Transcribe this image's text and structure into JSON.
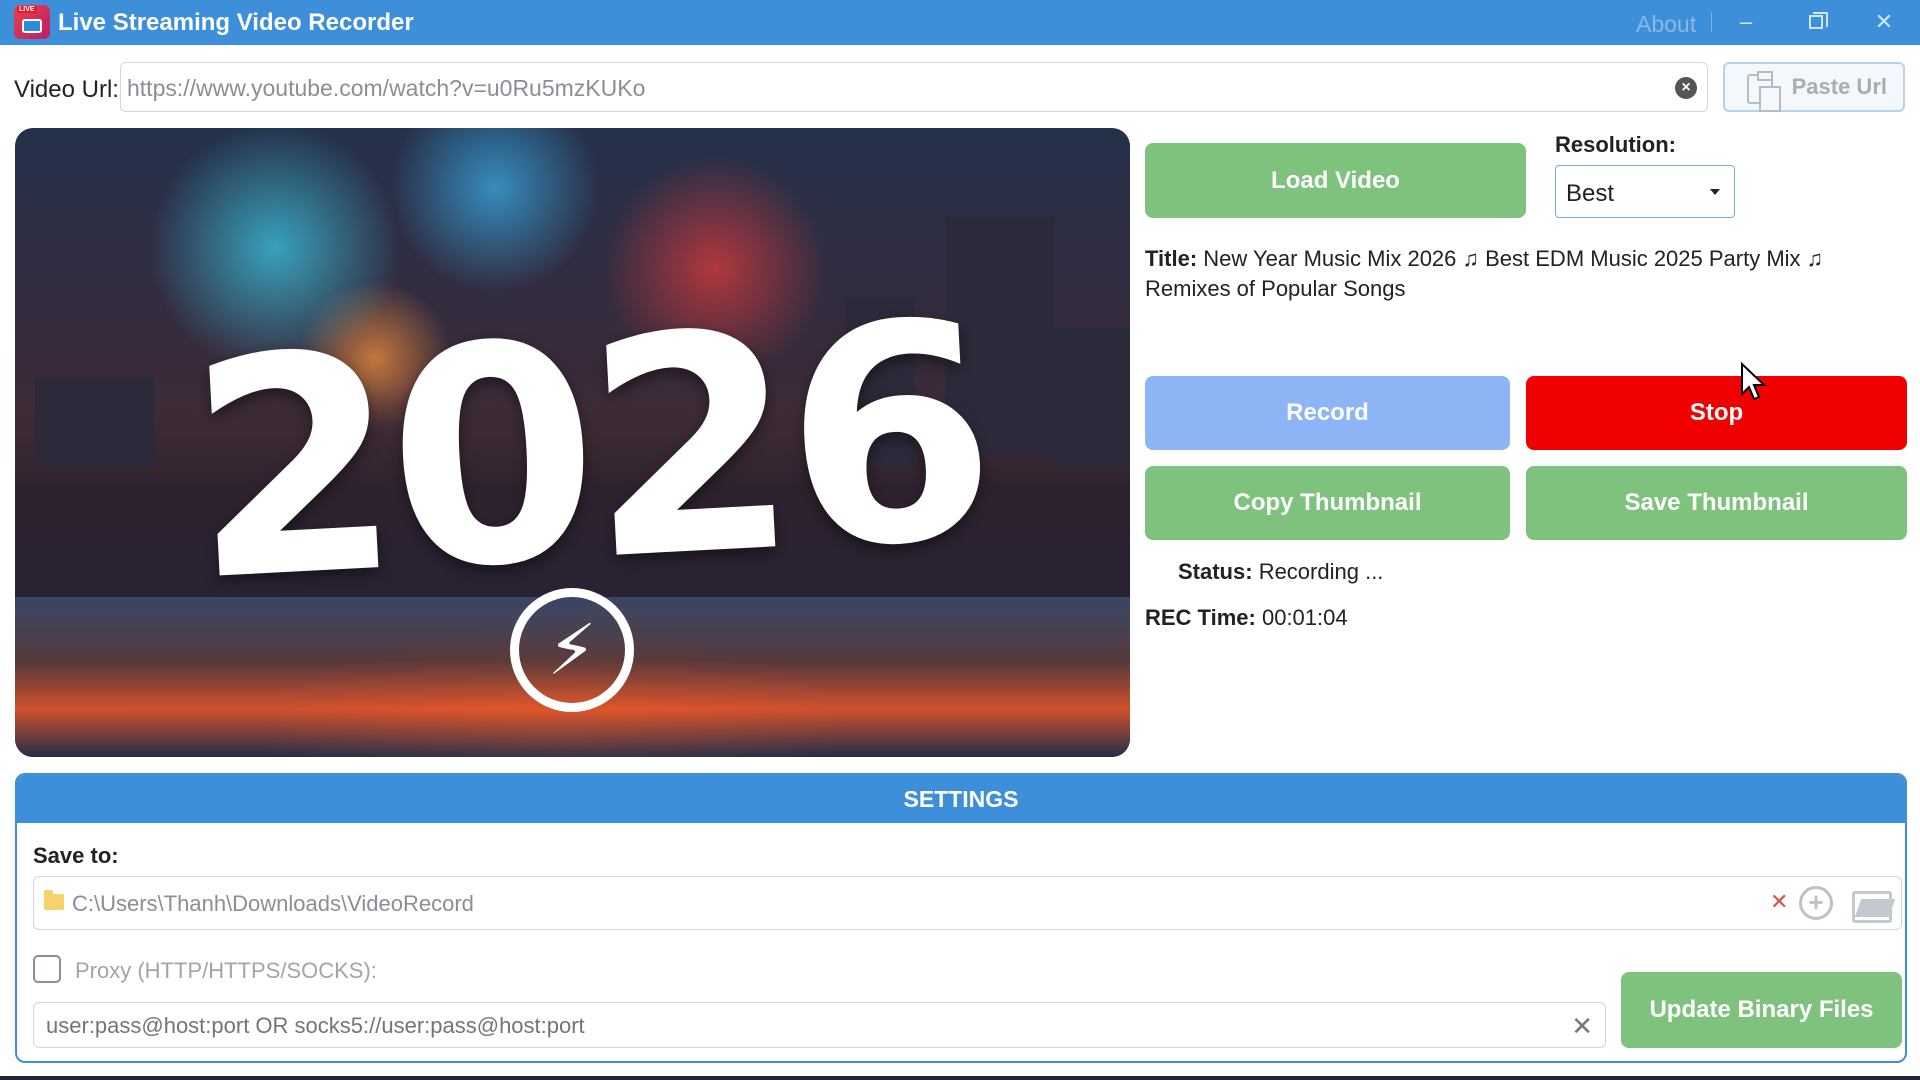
{
  "window": {
    "title": "Live Streaming Video Recorder",
    "icon_badge": "LIVE",
    "about": "About",
    "minimize_icon": "minimize-icon",
    "maximize_icon": "restore-icon",
    "close_icon": "close-icon"
  },
  "url_bar": {
    "label": "Video Url:",
    "value": "https://www.youtube.com/watch?v=u0Ru5mzKUKo",
    "paste_label": "Paste Url",
    "clear_icon": "clear-circle-icon",
    "paste_icon": "clipboard-icon"
  },
  "thumbnail": {
    "overlay_text": "2026",
    "logo_icon": "lightning-bolt-icon"
  },
  "controls": {
    "load_label": "Load Video",
    "resolution_label": "Resolution:",
    "resolution_value": "Best",
    "title_label": "Title:",
    "title_value": "New Year Music Mix 2026 ♫ Best EDM Music 2025 Party Mix ♫ Remixes of Popular Songs",
    "record_label": "Record",
    "stop_label": "Stop",
    "copy_thumb_label": "Copy Thumbnail",
    "save_thumb_label": "Save Thumbnail",
    "status_label": "Status:",
    "status_value": "Recording ...",
    "rec_time_label": "REC Time:",
    "rec_time_value": "00:01:04"
  },
  "settings": {
    "header": "SETTINGS",
    "save_to_label": "Save to:",
    "save_path": "C:\\Users\\Thanh\\Downloads\\VideoRecord",
    "proxy_label": "Proxy (HTTP/HTTPS/SOCKS):",
    "proxy_checked": false,
    "proxy_placeholder": "user:pass@host:port OR socks5://user:pass@host:port",
    "update_label": "Update Binary Files"
  },
  "colors": {
    "accent": "#3d8fd9",
    "green_button": "#7ec27e",
    "record_button": "#8db4f5",
    "stop_button": "#f00000"
  }
}
